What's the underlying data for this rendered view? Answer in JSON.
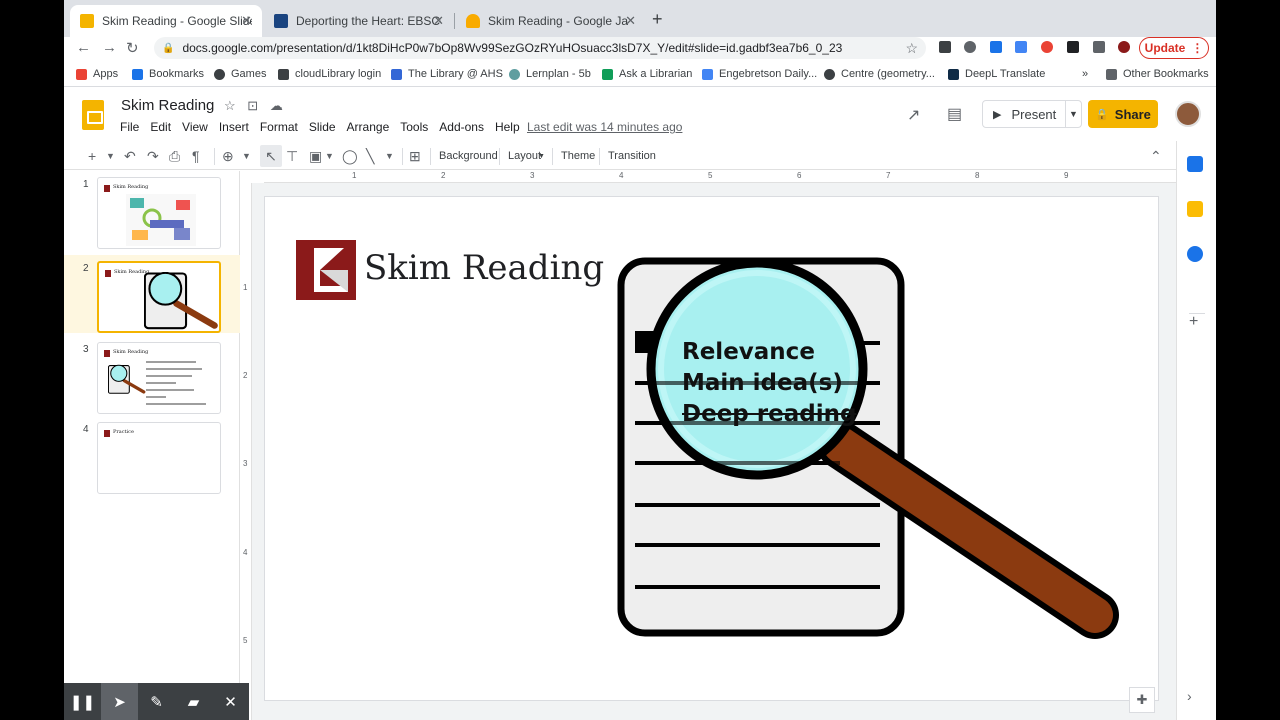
{
  "browser": {
    "tabs": [
      {
        "title": "Skim Reading - Google Slides",
        "favicon_color": "#f4b400",
        "active": true
      },
      {
        "title": "Deporting the Heart: EBSCOhost",
        "favicon_color": "#1a4480",
        "active": false
      },
      {
        "title": "Skim Reading - Google Jamboard",
        "favicon_color": "#f9ab00",
        "active": false
      }
    ],
    "url": "docs.google.com/presentation/d/1kt8DiHcP0w7bOp8Wv99SezGOzRYuHOsuacc3lsD7X_Y/edit#slide=id.gadbf3ea7b6_0_23",
    "update_label": "Update",
    "bookmarks": [
      {
        "label": "Apps",
        "color": "#ea4335"
      },
      {
        "label": "Bookmarks",
        "color": "#1a73e8"
      },
      {
        "label": "Games",
        "color": "#3c4043"
      },
      {
        "label": "cloudLibrary login",
        "color": "#3c4043"
      },
      {
        "label": "The Library @ AHS",
        "color": "#3367d6"
      },
      {
        "label": "Lernplan - 5b",
        "color": "#5f9ea0"
      },
      {
        "label": "Ask a Librarian",
        "color": "#0f9d58"
      },
      {
        "label": "Engebretson Daily...",
        "color": "#4285f4"
      },
      {
        "label": "Centre (geometry...",
        "color": "#3c4043"
      },
      {
        "label": "DeepL Translate",
        "color": "#0f2b46"
      }
    ],
    "bookmarks_overflow": "»",
    "other_bookmarks": "Other Bookmarks"
  },
  "doc": {
    "title": "Skim Reading",
    "menus": [
      "File",
      "Edit",
      "View",
      "Insert",
      "Format",
      "Slide",
      "Arrange",
      "Tools",
      "Add-ons",
      "Help"
    ],
    "last_edit": "Last edit was 14 minutes ago",
    "present_label": "Present",
    "share_label": "Share"
  },
  "toolbar": {
    "background": "Background",
    "layout": "Layout",
    "theme": "Theme",
    "transition": "Transition"
  },
  "slides": [
    {
      "number": "1",
      "title": "Skim Reading"
    },
    {
      "number": "2",
      "title": "Skim Reading"
    },
    {
      "number": "3",
      "title": "Skim Reading"
    },
    {
      "number": "4",
      "title": "Practice"
    }
  ],
  "ruler": {
    "top": [
      "1",
      "2",
      "3",
      "4",
      "5",
      "6",
      "7",
      "8",
      "9"
    ],
    "left": [
      "1",
      "2",
      "3",
      "4",
      "5"
    ]
  },
  "slide": {
    "title": "Skim Reading",
    "lens_lines": [
      "Relevance",
      "Main idea(s)",
      "Deep reading"
    ]
  },
  "colors": {
    "accent": "#f4b400",
    "logo_red": "#8b1a1a",
    "lens": "#a8f0f0",
    "handle": "#8b3a10"
  }
}
